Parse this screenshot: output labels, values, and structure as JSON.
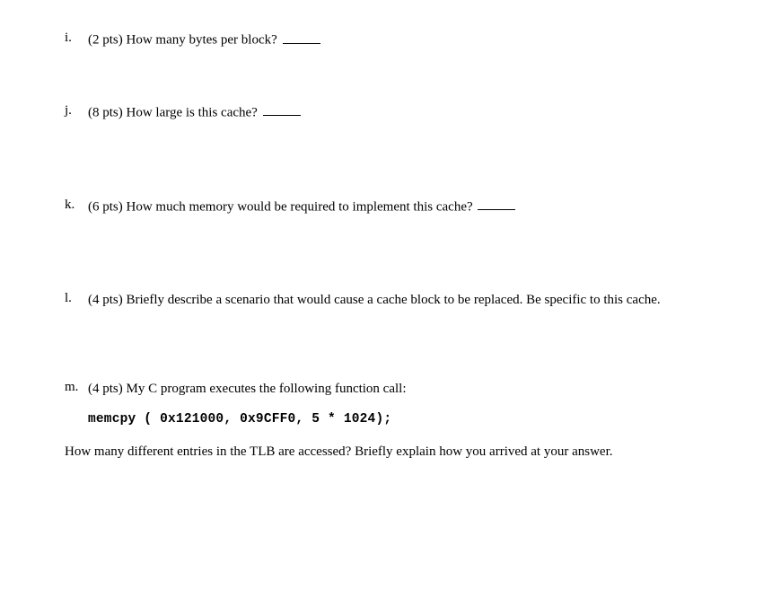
{
  "questions": {
    "i": {
      "marker": "i.",
      "text": "(2 pts) How many bytes per block?"
    },
    "j": {
      "marker": "j.",
      "text": "(8 pts) How large is this cache?"
    },
    "k": {
      "marker": "k.",
      "text": "(6 pts) How much memory would be required to implement this cache?"
    },
    "l": {
      "marker": "l.",
      "text": "(4 pts) Briefly describe a scenario that would cause a cache block to be replaced. Be specific to this cache."
    },
    "m": {
      "marker": "m.",
      "text": "(4 pts) My C program executes the following function call:",
      "code": "memcpy ( 0x121000, 0x9CFF0, 5 * 1024);",
      "followup": "How many different entries in the TLB are accessed? Briefly explain how you arrived at your answer."
    }
  }
}
